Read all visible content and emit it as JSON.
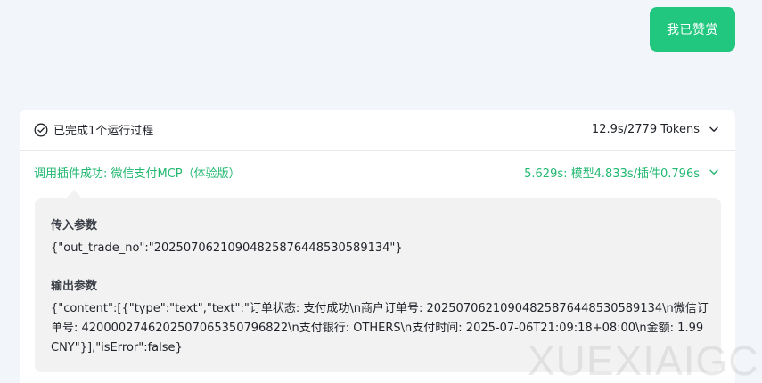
{
  "chat": {
    "user_message": "我已赞赏"
  },
  "run_summary": {
    "status_text": "已完成1个运行过程",
    "timing_tokens": "12.9s/2779 Tokens"
  },
  "plugin_call": {
    "label": "调用插件成功: 微信支付MCP（体验版）",
    "timing": "5.629s: 模型4.833s/插件0.796s"
  },
  "input_params": {
    "title": "传入参数",
    "value": "{\"out_trade_no\":\"20250706210904825876448530589134\"}"
  },
  "output_params": {
    "title": "输出参数",
    "value": "{\"content\":[{\"type\":\"text\",\"text\":\"订单状态: 支付成功\\n商户订单号: 20250706210904825876448530589134\\n微信订单号: 4200002746202507065350796822\\n支付银行: OTHERS\\n支付时间: 2025-07-06T21:09:18+08:00\\n金额: 1.99 CNY\"}],\"isError\":false}"
  },
  "watermark": "XUEXIAIGC",
  "colors": {
    "accent": "#21c77f",
    "plugin_text": "#21b870",
    "panel_bg": "#f2f2f2",
    "page_bg": "#f2f5f9"
  },
  "icons": {
    "status": "check-circle-icon",
    "expand": "chevron-down-icon"
  }
}
